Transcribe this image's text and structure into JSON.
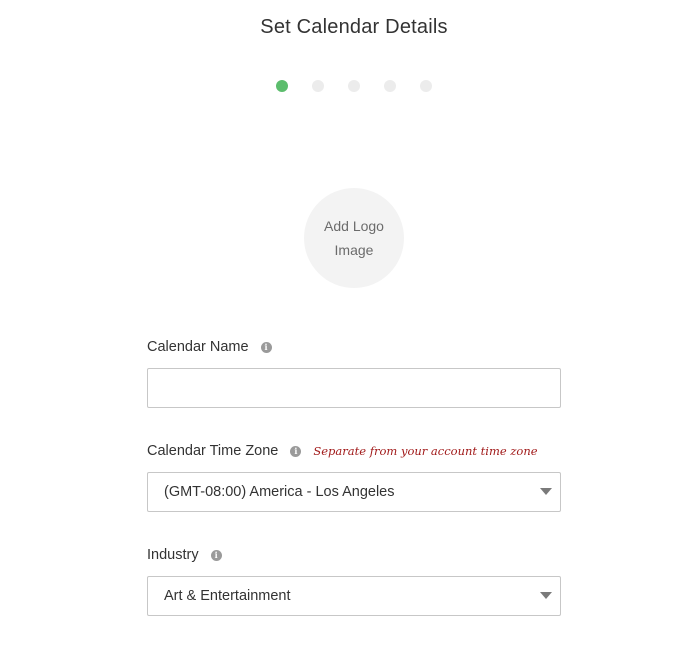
{
  "page": {
    "title": "Set Calendar Details"
  },
  "steps": {
    "total": 5,
    "current": 1
  },
  "logo": {
    "line1": "Add Logo",
    "line2": "Image"
  },
  "fields": {
    "calendar_name": {
      "label": "Calendar Name",
      "value": "",
      "info_icon": "info-icon"
    },
    "time_zone": {
      "label": "Calendar Time Zone",
      "hint": "Separate from your account time zone",
      "value": "(GMT-08:00) America - Los Angeles",
      "info_icon": "info-icon"
    },
    "industry": {
      "label": "Industry",
      "value": "Art & Entertainment",
      "info_icon": "info-icon"
    }
  },
  "colors": {
    "step_active": "#5cbd6d",
    "step_inactive": "#ececec",
    "hint": "#a11a1a"
  }
}
